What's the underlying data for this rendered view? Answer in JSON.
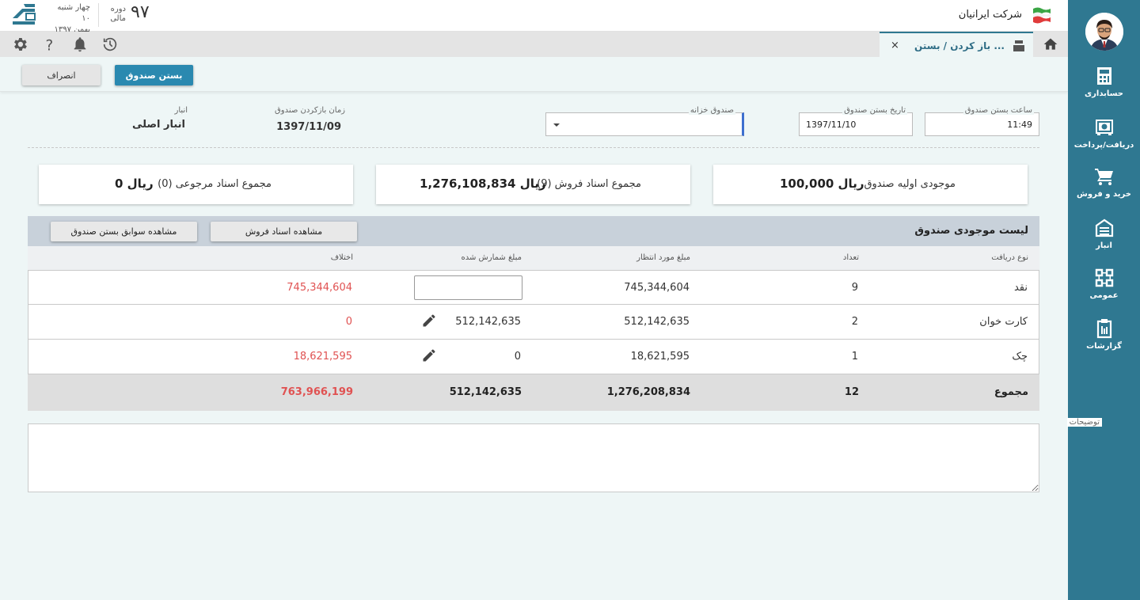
{
  "header": {
    "company": "شرکت ایرانیان",
    "period_number": "۹۷",
    "period_label_1": "دوره",
    "period_label_2": "مالی",
    "date_line_1": "چهار شنبه ۱۰",
    "date_line_2": "بهمن ۱۳۹۷"
  },
  "tab": {
    "title": "باز کردن / بستن ...",
    "close": "×"
  },
  "actions": {
    "close_register": "بستن صندوق",
    "cancel": "انصراف"
  },
  "form": {
    "close_time_label": "ساعت بستن صندوق",
    "close_time_value": "11:49",
    "close_date_label": "تاریخ بستن صندوق",
    "close_date_value": "1397/11/10",
    "treasury_label": "صندوق خزانه",
    "open_time_label": "زمان بازکردن صندوق",
    "open_time_value": "1397/11/09",
    "warehouse_label": "انبار",
    "warehouse_value": "انبار اصلی"
  },
  "cards": [
    {
      "label": "موجودی اولیه صندوق",
      "value": "100,000 ریال"
    },
    {
      "label": "مجموع اسناد فروش (9)",
      "value": "1,276,108,834 ریال"
    },
    {
      "label": "مجموع اسناد مرجوعی (0)",
      "value": "0 ریال"
    }
  ],
  "list": {
    "title": "لیست موجودی صندوق",
    "view_sales_docs": "مشاهده اسناد فروش",
    "view_close_history": "مشاهده سوابق بستن صندوق",
    "columns": {
      "type": "نوع دریافت",
      "count": "تعداد",
      "expected": "مبلغ مورد انتظار",
      "counted": "مبلغ شمارش شده",
      "difference": "اختلاف"
    },
    "rows": [
      {
        "type": "نقد",
        "count": "9",
        "expected": "745,344,604",
        "counted": "",
        "difference": "745,344,604"
      },
      {
        "type": "کارت خوان",
        "count": "2",
        "expected": "512,142,635",
        "counted": "512,142,635",
        "difference": "0"
      },
      {
        "type": "چک",
        "count": "1",
        "expected": "18,621,595",
        "counted": "0",
        "difference": "18,621,595"
      }
    ],
    "total": {
      "type": "مجموع",
      "count": "12",
      "expected": "1,276,208,834",
      "counted": "512,142,635",
      "difference": "763,966,199"
    }
  },
  "notes": {
    "label": "توضیحات"
  },
  "sidebar": {
    "items": [
      {
        "label": "حسابداری",
        "icon": "accounting-icon"
      },
      {
        "label": "دریافت/پرداخت",
        "icon": "safe-icon"
      },
      {
        "label": "خرید و فروش",
        "icon": "cart-icon"
      },
      {
        "label": "انبار",
        "icon": "warehouse-icon"
      },
      {
        "label": "عمومی",
        "icon": "general-icon"
      },
      {
        "label": "گزارشات",
        "icon": "reports-icon"
      }
    ]
  },
  "colors": {
    "sidebar": "#2f7891",
    "primary_button": "#2a89b0",
    "difference": "#e05252"
  }
}
